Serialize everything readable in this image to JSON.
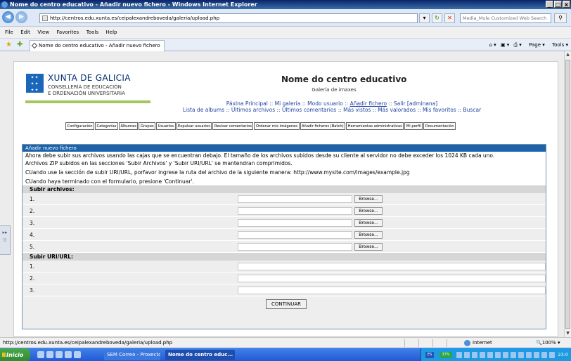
{
  "window": {
    "title": "Nome do centro educativo - Añadir nuevo fichero - Windows Internet Explorer",
    "controls": [
      "_",
      "□",
      "x"
    ]
  },
  "address": {
    "url": "http://centros.edu.xunta.es/ceipalexandreboveda/galeria/upload.php",
    "search_placeholder": "Media_Mule Customized Web Search"
  },
  "menu": [
    "File",
    "Edit",
    "View",
    "Favorites",
    "Tools",
    "Help"
  ],
  "tabs": [
    {
      "label": "Nome do centro educativo - Añadir nuevo fichero"
    }
  ],
  "command_bar": {
    "page": "Page",
    "tools": "Tools"
  },
  "logo": {
    "title": "XUNTA DE GALICIA",
    "line1": "CONSELLERÍA DE EDUCACIÓN",
    "line2": "E ORDENACIÓN UNIVERSITARIA"
  },
  "site": {
    "title": "Nome do centro educativo",
    "subtitle": "Galería de imaxes"
  },
  "nav": {
    "line1_pre": "Páxina Principal :: Mi galería :: Modo usuario :: ",
    "line1_current": "Añadir fichero",
    "line1_post": " :: Salir [adminana]",
    "line2": "Lista de albums :: Últimos archivos :: Últimos comentarios :: Más vistos :: Más valorados :: Mis favoritos :: Buscar"
  },
  "admin_buttons": [
    "Configuración",
    "Categorías",
    "Álbumes",
    "Grupos",
    "Usuarios",
    "Expulsar usuarios",
    "Revisar comentarios",
    "Ordenar mis imágenes",
    "Añadir ficheros (Batch)",
    "Herramientas administrativas",
    "Mi perfil",
    "Documentación"
  ],
  "form": {
    "header": "Añadir nuevo fichero",
    "msg1": "Ahora debe subir sus archivos usando las cajas que se encuentran debajo. El tamaño de los archivos subidos desde su cliente al servidor no debe exceder los 1024 KB cada uno.",
    "msg2": "Archivos ZIP subidos en las secciones 'Subir Archivos' y 'Subir URI/URL' se mantendran comprimidos.",
    "msg3": "CUando use la sección de subir URI/URL, porfavor ingrese la ruta del archivo de la siguiente manera: http://www.mysite.com/images/example.jpg",
    "msg4": "CUando haya terminado con el formulario, presione 'Continuar'.",
    "files_section": "Subir archivos:",
    "file_rows": [
      "1.",
      "2.",
      "3.",
      "4.",
      "5."
    ],
    "browse_label": "Browse...",
    "url_section": "Subir URI/URL:",
    "url_rows": [
      "1.",
      "2.",
      "3."
    ],
    "continue_label": "CONTINUAR"
  },
  "status": {
    "url": "http://centros.edu.xunta.es/ceipalexandreboveda/galeria/upload.php",
    "zone": "Internet",
    "zoom": "100%"
  },
  "taskbar": {
    "start": "Inicio",
    "tasks": [
      "SEM Correo - Proxecto S...",
      "Nome do centro educ..."
    ],
    "lang": "ES",
    "battery": "37%",
    "clock": "23:0"
  }
}
